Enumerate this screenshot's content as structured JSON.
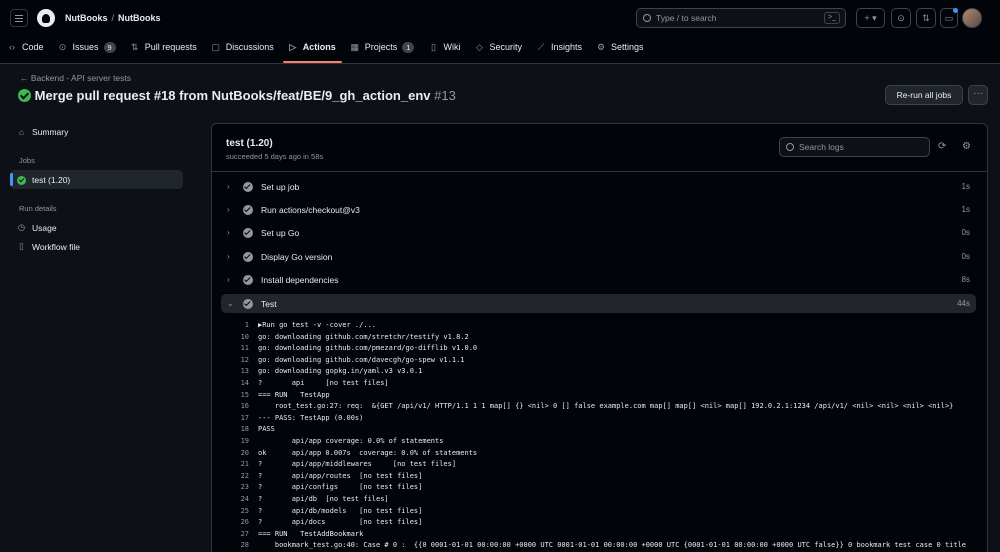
{
  "header": {
    "owner": "NutBooks",
    "repo": "NutBooks",
    "search_placeholder": "Type / to search",
    "search_key": ">_"
  },
  "nav_tabs": [
    {
      "label": "Code",
      "icon": "code-icon"
    },
    {
      "label": "Issues",
      "icon": "issue-icon",
      "count": "9"
    },
    {
      "label": "Pull requests",
      "icon": "pull-request-icon"
    },
    {
      "label": "Discussions",
      "icon": "discussions-icon"
    },
    {
      "label": "Actions",
      "icon": "play-icon",
      "active": true
    },
    {
      "label": "Projects",
      "icon": "table-icon",
      "count": "1"
    },
    {
      "label": "Wiki",
      "icon": "book-icon"
    },
    {
      "label": "Security",
      "icon": "shield-icon"
    },
    {
      "label": "Insights",
      "icon": "graph-icon"
    },
    {
      "label": "Settings",
      "icon": "gear-icon"
    }
  ],
  "run": {
    "back_label": "← Backend - API server tests",
    "title": "Merge pull request #18 from NutBooks/feat/BE/9_gh_action_env",
    "number": "#13",
    "rerun_label": "Re-run all jobs",
    "more_label": "···"
  },
  "sidebar": {
    "summary": "Summary",
    "jobs_heading": "Jobs",
    "job": "test (1.20)",
    "details_heading": "Run details",
    "usage": "Usage",
    "workflow_file": "Workflow file"
  },
  "job": {
    "title": "test (1.20)",
    "subtitle": "succeeded 5 days ago in 58s",
    "search_placeholder": "Search logs",
    "steps": [
      {
        "name": "Set up job",
        "duration": "1s"
      },
      {
        "name": "Run actions/checkout@v3",
        "duration": "1s"
      },
      {
        "name": "Set up Go",
        "duration": "0s"
      },
      {
        "name": "Display Go version",
        "duration": "0s"
      },
      {
        "name": "Install dependencies",
        "duration": "8s"
      },
      {
        "name": "Test",
        "duration": "44s",
        "open": true
      }
    ],
    "log_lines": [
      {
        "n": "1",
        "t": "▶Run go test -v -cover ./..."
      },
      {
        "n": "10",
        "t": "go: downloading github.com/stretchr/testify v1.8.2"
      },
      {
        "n": "11",
        "t": "go: downloading github.com/pmezard/go-difflib v1.0.0"
      },
      {
        "n": "12",
        "t": "go: downloading github.com/davecgh/go-spew v1.1.1"
      },
      {
        "n": "13",
        "t": "go: downloading gopkg.in/yaml.v3 v3.0.1"
      },
      {
        "n": "14",
        "t": "?       api     [no test files]"
      },
      {
        "n": "15",
        "t": "=== RUN   TestApp"
      },
      {
        "n": "16",
        "t": "    root_test.go:27: req:  &{GET /api/v1/ HTTP/1.1 1 1 map[] {} <nil> 0 [] false example.com map[] map[] <nil> map[] 192.0.2.1:1234 /api/v1/ <nil> <nil> <nil> <nil>}"
      },
      {
        "n": "17",
        "t": "--- PASS: TestApp (0.00s)"
      },
      {
        "n": "18",
        "t": "PASS"
      },
      {
        "n": "19",
        "t": "        api/app coverage: 0.0% of statements"
      },
      {
        "n": "20",
        "t": "ok      api/app 0.007s  coverage: 0.0% of statements"
      },
      {
        "n": "21",
        "t": "?       api/app/middlewares     [no test files]"
      },
      {
        "n": "22",
        "t": "?       api/app/routes  [no test files]"
      },
      {
        "n": "23",
        "t": "?       api/configs     [no test files]"
      },
      {
        "n": "24",
        "t": "?       api/db  [no test files]"
      },
      {
        "n": "25",
        "t": "?       api/db/models   [no test files]"
      },
      {
        "n": "26",
        "t": "?       api/docs        [no test files]"
      },
      {
        "n": "27",
        "t": "=== RUN   TestAddBookmark"
      },
      {
        "n": "28",
        "t": "    bookmark_test.go:40: Case # 0 :  {{0 0001-01-01 00:00:00 +0000 UTC 0001-01-01 00:00:00 +0000 UTC {0001-01-01 00:00:00 +0000 UTC false}} 0 bookmark test case 0 title"
      }
    ]
  }
}
